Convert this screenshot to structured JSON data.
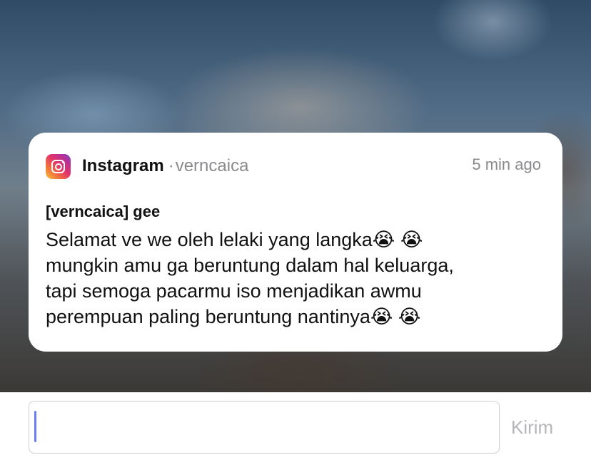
{
  "notification": {
    "app_name": "Instagram",
    "separator": "·",
    "account": "verncaica",
    "timestamp": "5 min ago",
    "app_icon": "instagram-icon",
    "title": "[verncaica] gee",
    "body_lines": [
      "Selamat ve we oleh lelaki yang langka😭 😭",
      "mungkin amu ga beruntung dalam hal keluarga,",
      "tapi semoga pacarmu iso menjadikan awmu",
      "perempuan paling beruntung nantinya😭 😭"
    ]
  },
  "reply": {
    "input_value": "",
    "send_label": "Kirim"
  },
  "colors": {
    "muted_text": "#8a8a8e",
    "send_disabled": "#b6b6ba",
    "caret": "#6a7ef2"
  }
}
